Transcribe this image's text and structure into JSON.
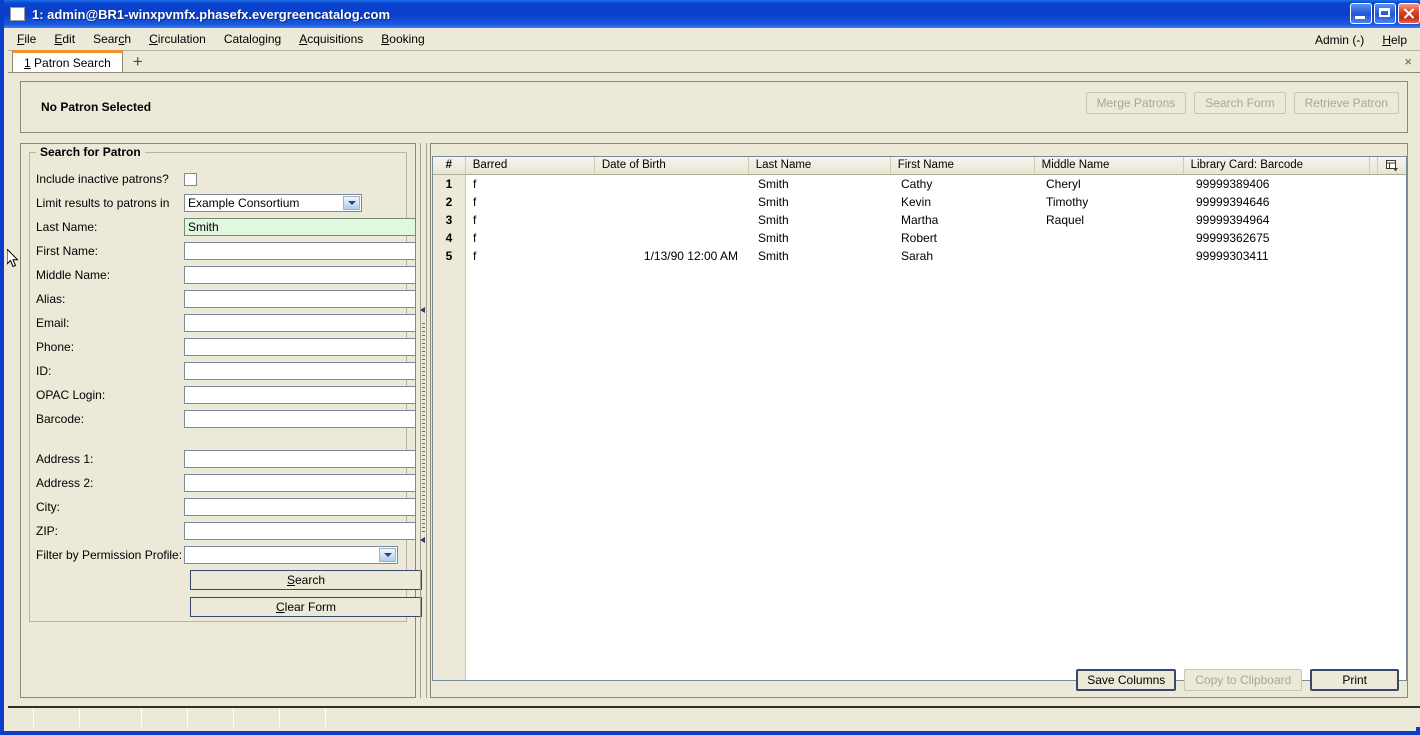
{
  "window": {
    "title": "1: admin@BR1-winxpvmfx.phasefx.evergreencatalog.com",
    "minimize_label": "Minimize",
    "maximize_label": "Maximize",
    "close_label": "Close"
  },
  "menubar": {
    "items": [
      {
        "label": "File",
        "mnemonic": "F"
      },
      {
        "label": "Edit",
        "mnemonic": "E"
      },
      {
        "label": "Search",
        "mnemonic": "c"
      },
      {
        "label": "Circulation",
        "mnemonic": "C"
      },
      {
        "label": "Cataloging",
        "mnemonic": "g"
      },
      {
        "label": "Acquisitions",
        "mnemonic": "A"
      },
      {
        "label": "Booking",
        "mnemonic": "B"
      }
    ],
    "right_items": [
      {
        "label": "Admin (-)",
        "mnemonic": ""
      },
      {
        "label": "Help",
        "mnemonic": "H"
      }
    ]
  },
  "tabs": {
    "active": {
      "number": "1",
      "label": "Patron Search"
    },
    "new_tab_label": "+",
    "close_label": "×"
  },
  "patron_header": {
    "status_text": "No Patron Selected",
    "buttons": [
      {
        "label": "Merge Patrons",
        "enabled": false
      },
      {
        "label": "Search Form",
        "enabled": false
      },
      {
        "label": "Retrieve Patron",
        "enabled": false
      }
    ]
  },
  "search_form": {
    "group_title": "Search for Patron",
    "fields": [
      {
        "label": "Include inactive patrons?",
        "type": "checkbox",
        "value": "",
        "checked": false
      },
      {
        "label": "Limit results to patrons in",
        "type": "combo",
        "value": "Example Consortium"
      },
      {
        "label": "Last Name:",
        "type": "text",
        "value": "Smith",
        "focused": true
      },
      {
        "label": "First Name:",
        "type": "text",
        "value": ""
      },
      {
        "label": "Middle Name:",
        "type": "text",
        "value": ""
      },
      {
        "label": "Alias:",
        "type": "text",
        "value": ""
      },
      {
        "label": "Email:",
        "type": "text",
        "value": ""
      },
      {
        "label": "Phone:",
        "type": "text",
        "value": ""
      },
      {
        "label": "ID:",
        "type": "text",
        "value": ""
      },
      {
        "label": "OPAC Login:",
        "type": "text",
        "value": ""
      },
      {
        "label": "Barcode:",
        "type": "text",
        "value": ""
      },
      {
        "label": "Address 1:",
        "type": "text",
        "value": ""
      },
      {
        "label": "Address 2:",
        "type": "text",
        "value": ""
      },
      {
        "label": "City:",
        "type": "text",
        "value": ""
      },
      {
        "label": "ZIP:",
        "type": "text",
        "value": ""
      },
      {
        "label": "Filter by Permission Profile:",
        "type": "combo",
        "value": ""
      }
    ],
    "search_button": "Search",
    "clear_button": "Clear Form"
  },
  "results": {
    "columns": [
      "#",
      "Barred",
      "Date of Birth",
      "Last Name",
      "First Name",
      "Middle Name",
      "Library Card: Barcode"
    ],
    "rows": [
      {
        "num": "1",
        "barred": "f",
        "dob": "",
        "last": "Smith",
        "first": "Cathy",
        "middle": "Cheryl",
        "barcode": "99999389406"
      },
      {
        "num": "2",
        "barred": "f",
        "dob": "",
        "last": "Smith",
        "first": "Kevin",
        "middle": "Timothy",
        "barcode": "99999394646"
      },
      {
        "num": "3",
        "barred": "f",
        "dob": "",
        "last": "Smith",
        "first": "Martha",
        "middle": "Raquel",
        "barcode": "99999394964"
      },
      {
        "num": "4",
        "barred": "f",
        "dob": "",
        "last": "Smith",
        "first": "Robert",
        "middle": "",
        "barcode": "99999362675"
      },
      {
        "num": "5",
        "barred": "f",
        "dob": "1/13/90 12:00 AM",
        "last": "Smith",
        "first": "Sarah",
        "middle": "",
        "barcode": "99999303411"
      }
    ],
    "buttons": [
      {
        "label": "Save Columns",
        "enabled": true,
        "default": true
      },
      {
        "label": "Copy to Clipboard",
        "enabled": false,
        "default": false
      },
      {
        "label": "Print",
        "enabled": true,
        "default": true
      }
    ]
  },
  "colors": {
    "titlebar_blue": "#0a3dc8",
    "window_beige": "#ece9d8",
    "focused_field_green": "#e2f7e0",
    "active_tab_orange": "#f0922b",
    "default_button_border": "#36486b"
  }
}
